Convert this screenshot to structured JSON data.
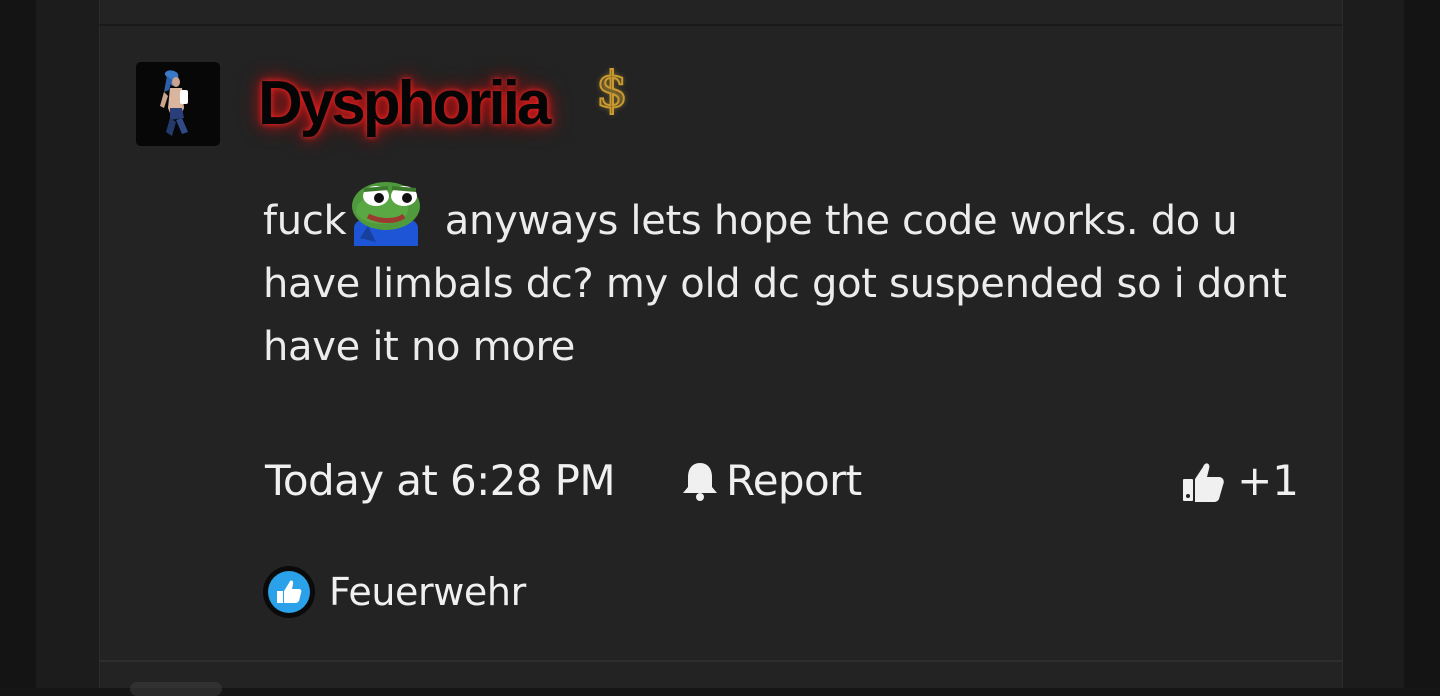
{
  "post": {
    "username": "Dysphoriia",
    "badge_icon": "dollar-sign-icon",
    "message": {
      "before_emote": "fuck",
      "emote": "pepe-frog-emote",
      "after_emote": " anyways lets hope the code works. do u have limbals dc? my old dc got suspended so i dont have it no more"
    },
    "timestamp": "Today at 6:28 PM",
    "report_label": "Report",
    "like_count": "+1",
    "reaction_user": "Feuerwehr"
  },
  "colors": {
    "background": "#232323",
    "text": "#ececec",
    "username_glow": "#e01e1e",
    "badge_gold": "#c99a2e",
    "reaction_blue": "#2aa1e8"
  }
}
